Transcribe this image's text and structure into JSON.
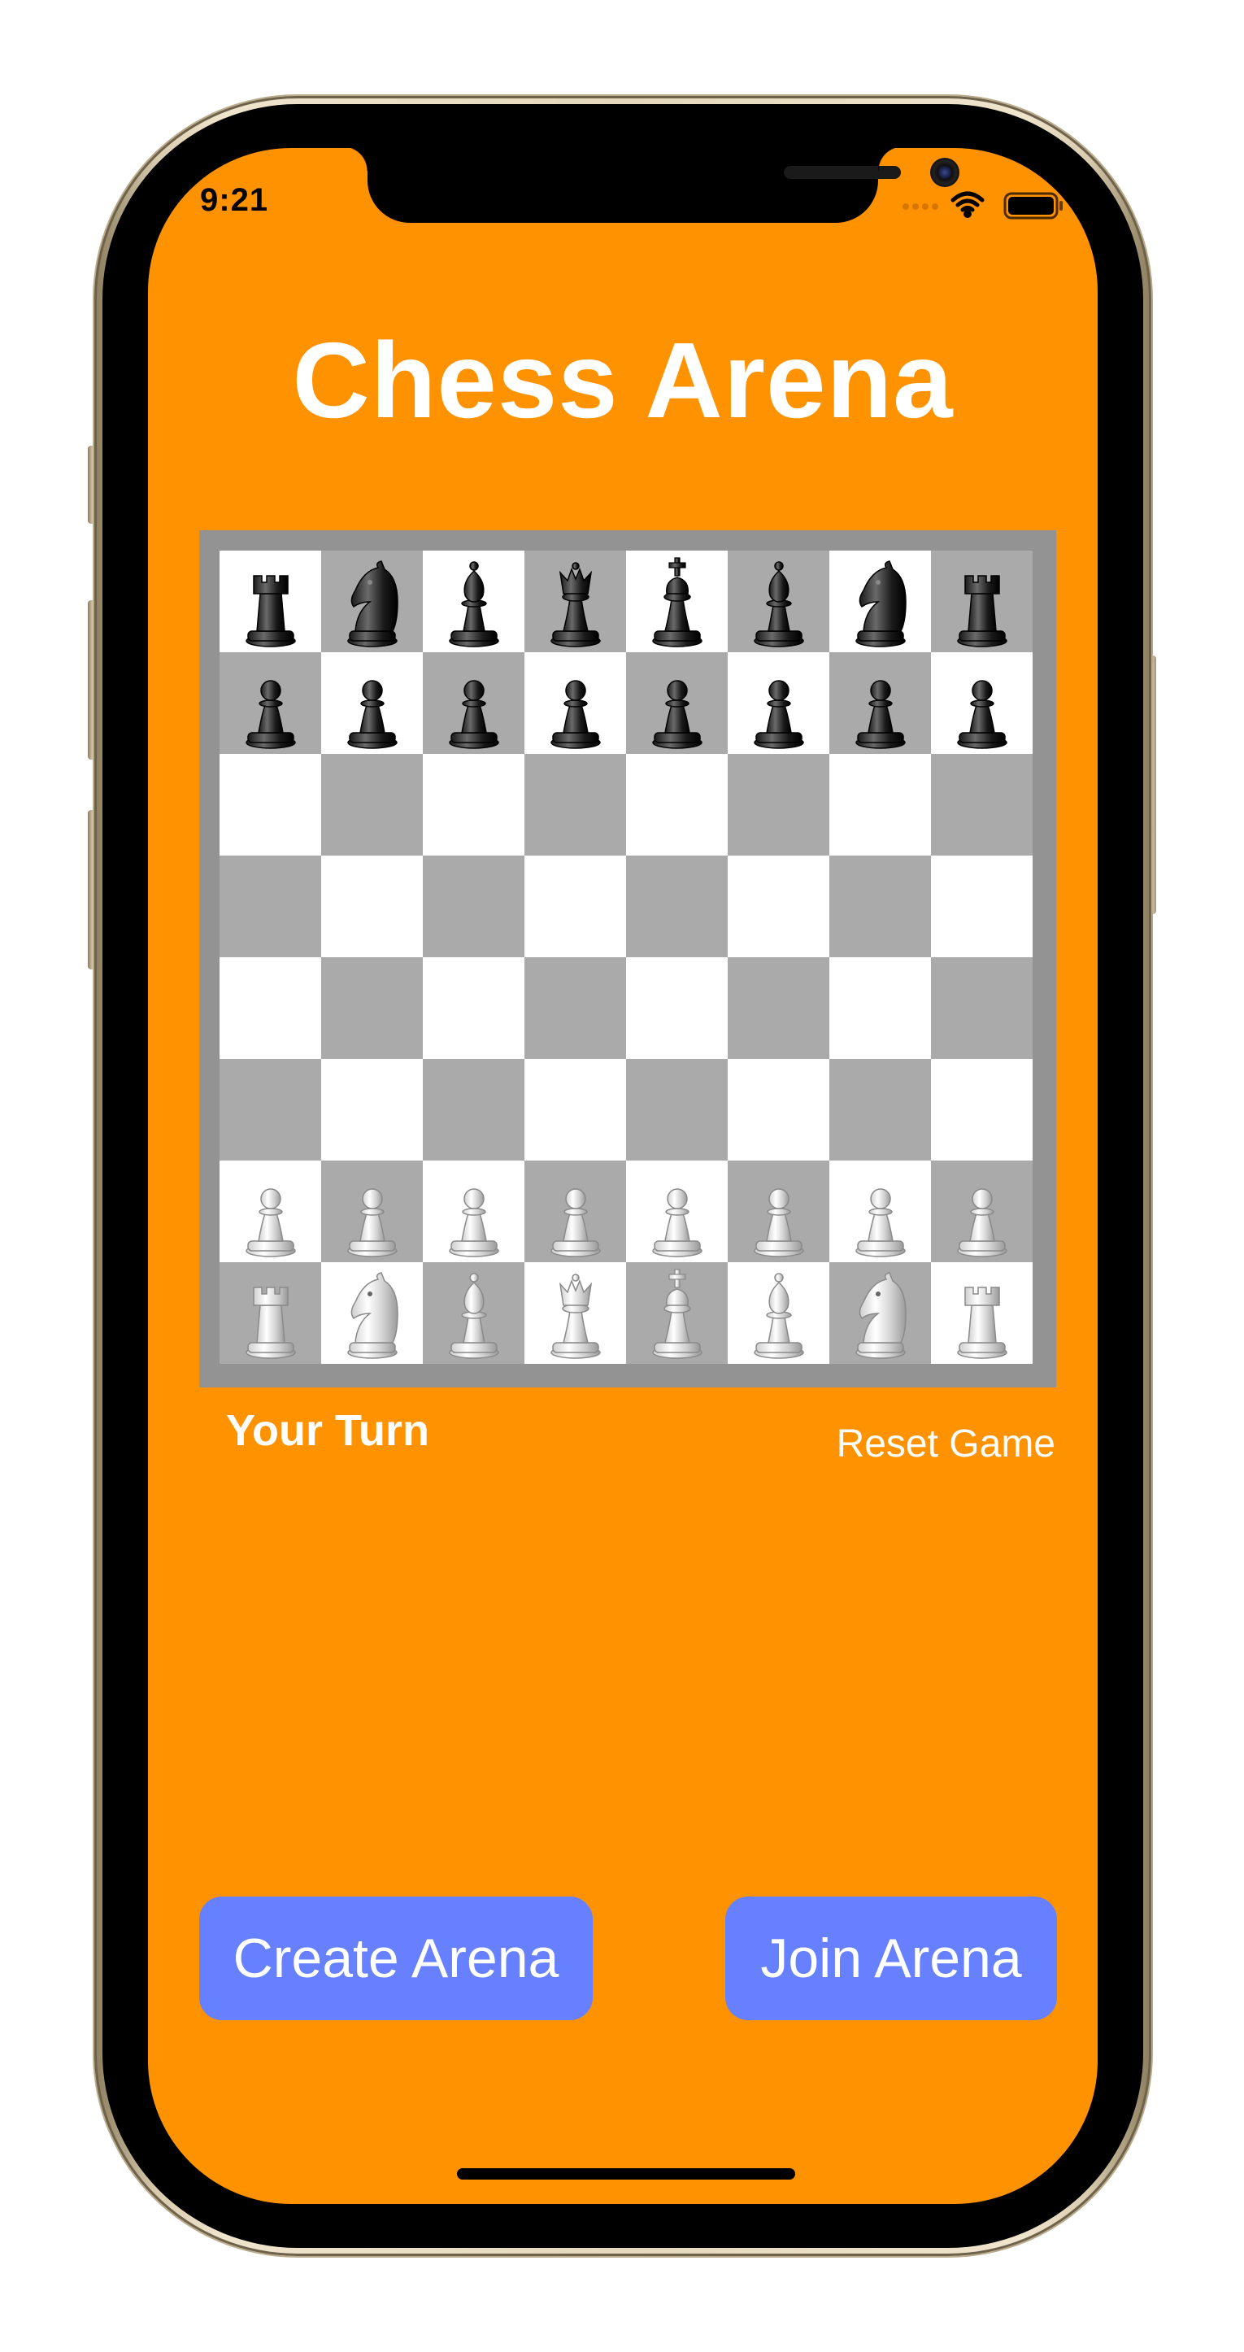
{
  "status_bar": {
    "time": "9:21",
    "icons": [
      "cellular-dots-icon",
      "wifi-icon",
      "battery-icon"
    ]
  },
  "app": {
    "title": "Chess Arena",
    "turn_label": "Your Turn",
    "reset_label": "Reset Game",
    "create_label": "Create Arena",
    "join_label": "Join Arena"
  },
  "board": {
    "rows": [
      [
        "rook-black",
        "knight-black",
        "bishop-black",
        "queen-black",
        "king-black",
        "bishop-black",
        "knight-black",
        "rook-black"
      ],
      [
        "pawn-black",
        "pawn-black",
        "pawn-black",
        "pawn-black",
        "pawn-black",
        "pawn-black",
        "pawn-black",
        "pawn-black"
      ],
      [
        "",
        "",
        "",
        "",
        "",
        "",
        "",
        ""
      ],
      [
        "",
        "",
        "",
        "",
        "",
        "",
        "",
        ""
      ],
      [
        "",
        "",
        "",
        "",
        "",
        "",
        "",
        ""
      ],
      [
        "",
        "",
        "",
        "",
        "",
        "",
        "",
        ""
      ],
      [
        "pawn-white",
        "pawn-white",
        "pawn-white",
        "pawn-white",
        "pawn-white",
        "pawn-white",
        "pawn-white",
        "pawn-white"
      ],
      [
        "rook-white",
        "knight-white",
        "bishop-white",
        "queen-white",
        "king-white",
        "bishop-white",
        "knight-white",
        "rook-white"
      ]
    ]
  },
  "colors": {
    "background": "#ff9200",
    "button": "#6680ff",
    "light_square": "#ffffff",
    "dark_square": "#aaaaaa",
    "board_border": "#939393"
  }
}
